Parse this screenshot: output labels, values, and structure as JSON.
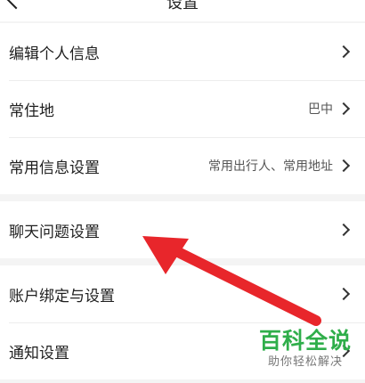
{
  "header": {
    "title": "设置"
  },
  "groups": [
    {
      "items": [
        {
          "label": "编辑个人信息",
          "value": ""
        },
        {
          "label": "常住地",
          "value": "巴中"
        },
        {
          "label": "常用信息设置",
          "value": "常用出行人、常用地址"
        }
      ]
    },
    {
      "items": [
        {
          "label": "聊天问题设置",
          "value": ""
        }
      ]
    },
    {
      "items": [
        {
          "label": "账户绑定与设置",
          "value": ""
        },
        {
          "label": "通知设置",
          "value": ""
        }
      ]
    }
  ],
  "annotation": {
    "arrow_color": "#e8262b"
  },
  "watermark": {
    "title": "百科全说",
    "subtitle": "助你轻松解决"
  }
}
